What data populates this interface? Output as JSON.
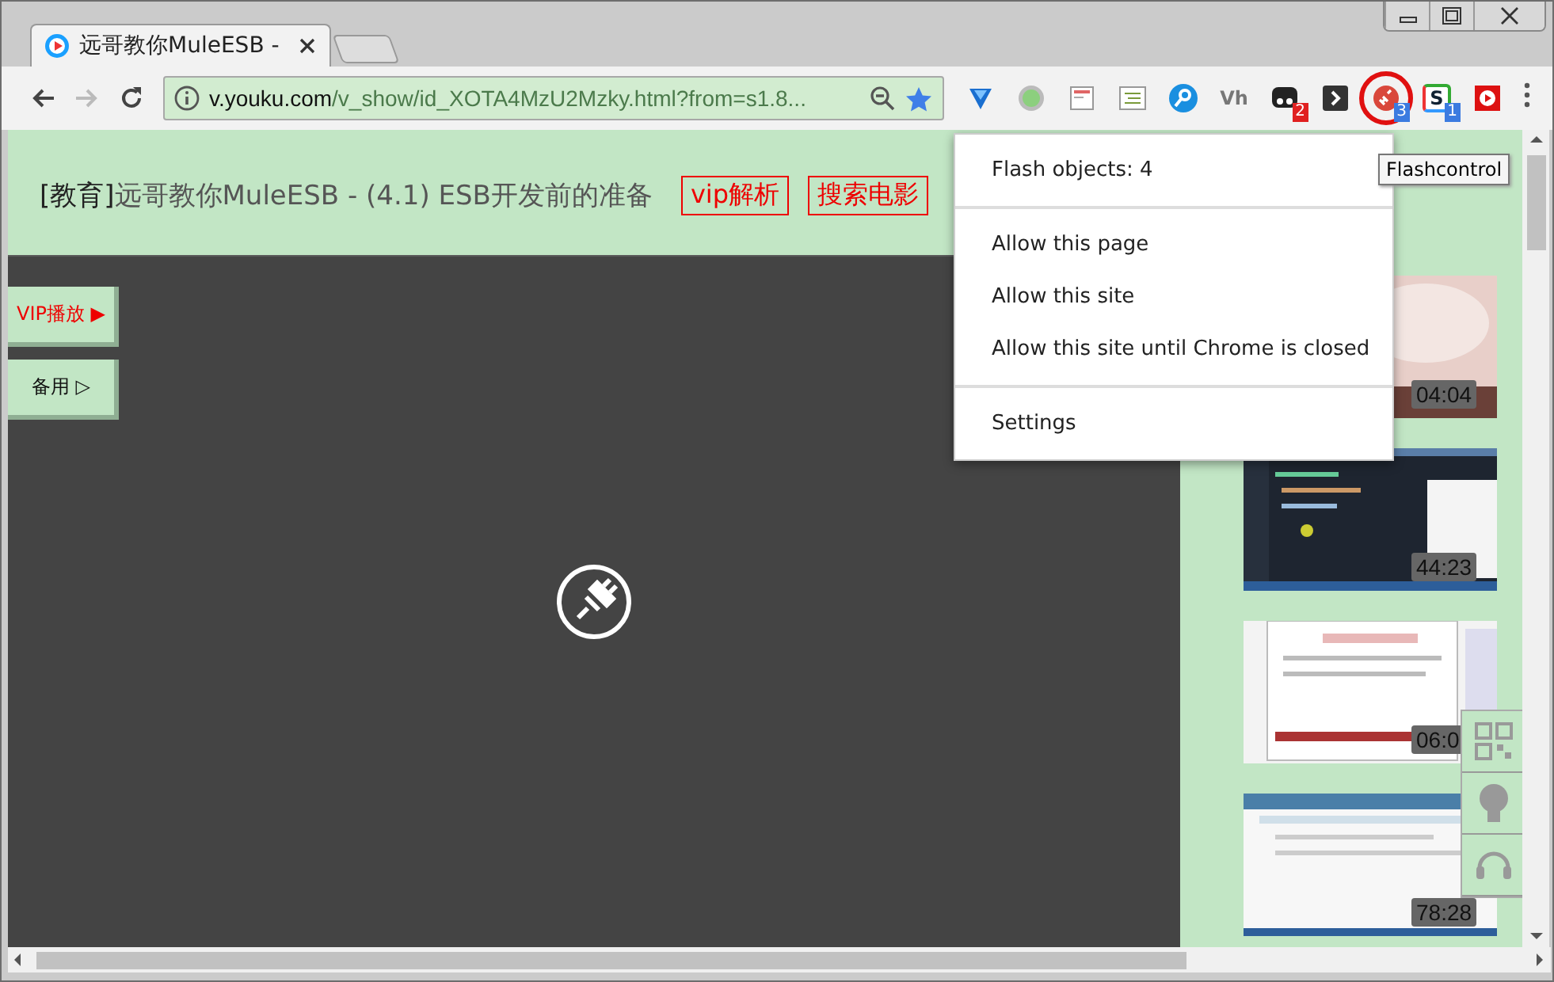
{
  "tab": {
    "title": "远哥教你MuleESB -",
    "selected": true
  },
  "address": {
    "host": "v.youku.com",
    "path": "/v_show/id_XOTA4MzU2Mzky.html?from=s1.8..."
  },
  "extensions": [
    {
      "kind": "diamond"
    },
    {
      "kind": "dot"
    },
    {
      "kind": "page"
    },
    {
      "kind": "notes"
    },
    {
      "kind": "key"
    },
    {
      "kind": "text",
      "label": "Vh"
    },
    {
      "kind": "ghost",
      "badge": "2"
    },
    {
      "kind": "bracket"
    },
    {
      "kind": "plug",
      "badge": "3",
      "circled": true
    },
    {
      "kind": "s",
      "label": "S",
      "badge": "1"
    },
    {
      "kind": "play"
    }
  ],
  "tooltip": "Flashcontrol",
  "page": {
    "category": "[教育]",
    "title": "远哥教你MuleESB - (4.1) ESB开发前的准备",
    "links": [
      "vip解析",
      "搜索电影"
    ],
    "side_buttons": [
      {
        "label": "VIP播放 ▶",
        "kind": "vip"
      },
      {
        "label": "备用 ▷",
        "kind": "spare"
      }
    ]
  },
  "menu": {
    "sections": [
      [
        {
          "label": "Flash objects: 4"
        }
      ],
      [
        {
          "label": "Allow this page"
        },
        {
          "label": "Allow this site"
        },
        {
          "label": "Allow this site until Chrome is closed"
        }
      ],
      [
        {
          "label": "Settings"
        }
      ]
    ]
  },
  "videos": [
    {
      "duration": "04:04"
    },
    {
      "kind": "code",
      "duration": "44:23"
    },
    {
      "kind": "document",
      "duration": "06:0"
    },
    {
      "kind": "web",
      "duration": "78:28"
    }
  ]
}
